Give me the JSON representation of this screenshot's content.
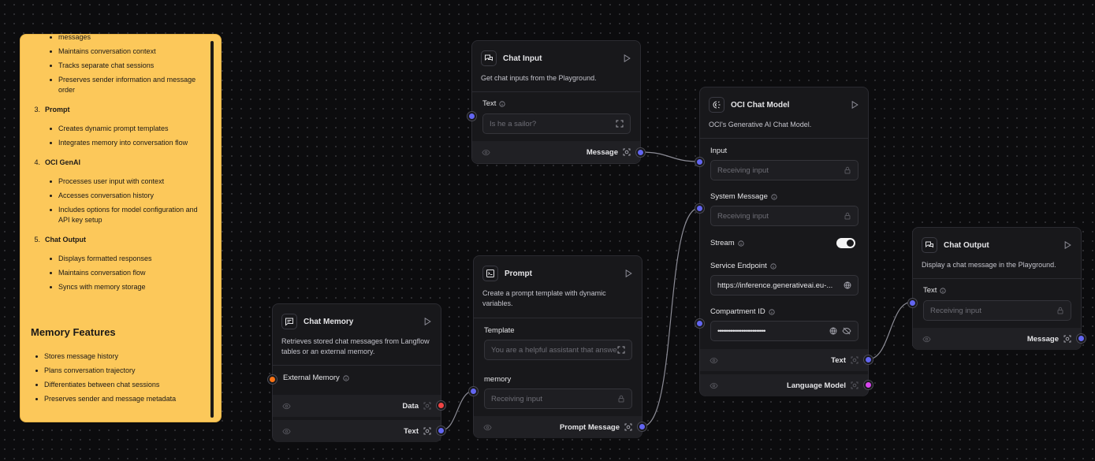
{
  "note": {
    "intro_tail": "messages",
    "intro_bullets": [
      "Maintains conversation context",
      "Tracks separate chat sessions",
      "Preserves sender information and message order"
    ],
    "sections": [
      {
        "num": "3.",
        "title": "Prompt",
        "bullets": [
          "Creates dynamic prompt templates",
          "Integrates memory into conversation flow"
        ]
      },
      {
        "num": "4.",
        "title": "OCI GenAI",
        "bullets": [
          "Processes user input with context",
          "Accesses conversation history",
          "Includes options for model configuration and API key setup"
        ]
      },
      {
        "num": "5.",
        "title": "Chat Output",
        "bullets": [
          "Displays formatted responses",
          "Maintains conversation flow",
          "Syncs with memory storage"
        ]
      }
    ],
    "features_heading": "Memory Features",
    "features": [
      "Stores message history",
      "Plans conversation trajectory",
      "Differentiates between chat sessions",
      "Preserves sender and message metadata"
    ]
  },
  "chat_input": {
    "title": "Chat Input",
    "description": "Get chat inputs from the Playground.",
    "text_label": "Text",
    "text_placeholder": "Is he a sailor?",
    "output_label": "Message"
  },
  "chat_memory": {
    "title": "Chat Memory",
    "description": "Retrieves stored chat messages from Langflow tables or an external memory.",
    "external_memory_label": "External Memory",
    "output_data_label": "Data",
    "output_text_label": "Text"
  },
  "prompt": {
    "title": "Prompt",
    "description": "Create a prompt template with dynamic variables.",
    "template_label": "Template",
    "template_value": "You are a helpful assistant that answers questions.",
    "memory_label": "memory",
    "memory_placeholder": "Receiving input",
    "output_label": "Prompt Message"
  },
  "oci_model": {
    "title": "OCI Chat Model",
    "description": "OCI's Generative AI Chat Model.",
    "input_label": "Input",
    "input_placeholder": "Receiving input",
    "system_message_label": "System Message",
    "system_message_placeholder": "Receiving input",
    "stream_label": "Stream",
    "stream_on": true,
    "endpoint_label": "Service Endpoint",
    "endpoint_value": "https://inference.generativeai.eu-...",
    "compartment_label": "Compartment ID",
    "compartment_value": "••••••••••••••••••••••••••",
    "output_text_label": "Text",
    "output_model_label": "Language Model"
  },
  "chat_output": {
    "title": "Chat Output",
    "description": "Display a chat message in the Playground.",
    "text_label": "Text",
    "text_placeholder": "Receiving input",
    "output_label": "Message"
  },
  "colors": {
    "note_bg": "#fcc85a",
    "canvas_bg": "#0c0c0e",
    "node_bg": "#18181b",
    "handle_message": "#6366f1",
    "handle_data": "#ef4444",
    "handle_memory": "#f97316",
    "handle_model": "#d946ef",
    "edge": "#8b8b95"
  }
}
